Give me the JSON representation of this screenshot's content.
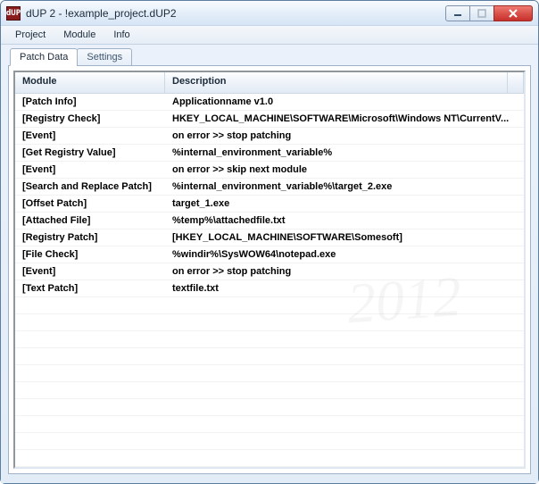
{
  "window": {
    "title": "dUP 2 - !example_project.dUP2",
    "app_icon_text": "dUP"
  },
  "menubar": {
    "items": [
      "Project",
      "Module",
      "Info"
    ]
  },
  "tabs": [
    {
      "label": "Patch Data",
      "active": true
    },
    {
      "label": "Settings",
      "active": false
    }
  ],
  "listview": {
    "columns": {
      "module": "Module",
      "description": "Description"
    },
    "rows": [
      {
        "module": "[Patch Info]",
        "description": "Applicationname v1.0"
      },
      {
        "module": "[Registry Check]",
        "description": "HKEY_LOCAL_MACHINE\\SOFTWARE\\Microsoft\\Windows NT\\CurrentV..."
      },
      {
        "module": "[Event]",
        "description": "on error  >>  stop patching"
      },
      {
        "module": "[Get Registry Value]",
        "description": "%internal_environment_variable%"
      },
      {
        "module": "[Event]",
        "description": "on error  >>  skip next module"
      },
      {
        "module": "[Search and Replace Patch]",
        "description": "%internal_environment_variable%\\target_2.exe"
      },
      {
        "module": "[Offset Patch]",
        "description": "target_1.exe"
      },
      {
        "module": "[Attached File]",
        "description": "%temp%\\attachedfile.txt"
      },
      {
        "module": "[Registry Patch]",
        "description": "[HKEY_LOCAL_MACHINE\\SOFTWARE\\Somesoft]"
      },
      {
        "module": "[File Check]",
        "description": "%windir%\\SysWOW64\\notepad.exe"
      },
      {
        "module": "[Event]",
        "description": "on error  >>  stop patching"
      },
      {
        "module": "[Text Patch]",
        "description": "textfile.txt"
      }
    ]
  }
}
